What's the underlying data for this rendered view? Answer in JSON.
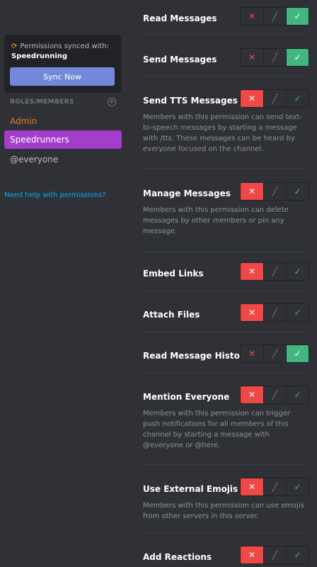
{
  "sidebar": {
    "sync": {
      "text": "Permissions synced with:",
      "role": "Speedrunning",
      "button": "Sync Now"
    },
    "roles_header": "ROLES/MEMBERS",
    "roles": [
      "Admin",
      "Speedrunners",
      "@everyone"
    ],
    "help": "Need help with permissions?"
  },
  "permissions": [
    {
      "title": "Read Messages",
      "desc": "",
      "state": "allow"
    },
    {
      "title": "Send Messages",
      "desc": "",
      "state": "allow"
    },
    {
      "title": "Send TTS Messages",
      "desc": "Members with this permission can send text-to-speech messages by starting a message with /tts. These messages can be heard by everyone focused on the channel.",
      "state": "deny"
    },
    {
      "title": "Manage Messages",
      "desc": "Members with this permission can delete messages by other members or pin any message.",
      "state": "deny"
    },
    {
      "title": "Embed Links",
      "desc": "",
      "state": "deny"
    },
    {
      "title": "Attach Files",
      "desc": "",
      "state": "deny"
    },
    {
      "title": "Read Message History",
      "desc": "",
      "state": "allow"
    },
    {
      "title": "Mention Everyone",
      "desc": "Members with this permission can trigger push notifications for all members of this channel by starting a message with @everyone or @here.",
      "state": "deny"
    },
    {
      "title": "Use External Emojis",
      "desc": "Members with this permission can use emojis from other servers in this server.",
      "state": "deny"
    },
    {
      "title": "Add Reactions",
      "desc": "",
      "state": "deny"
    }
  ]
}
